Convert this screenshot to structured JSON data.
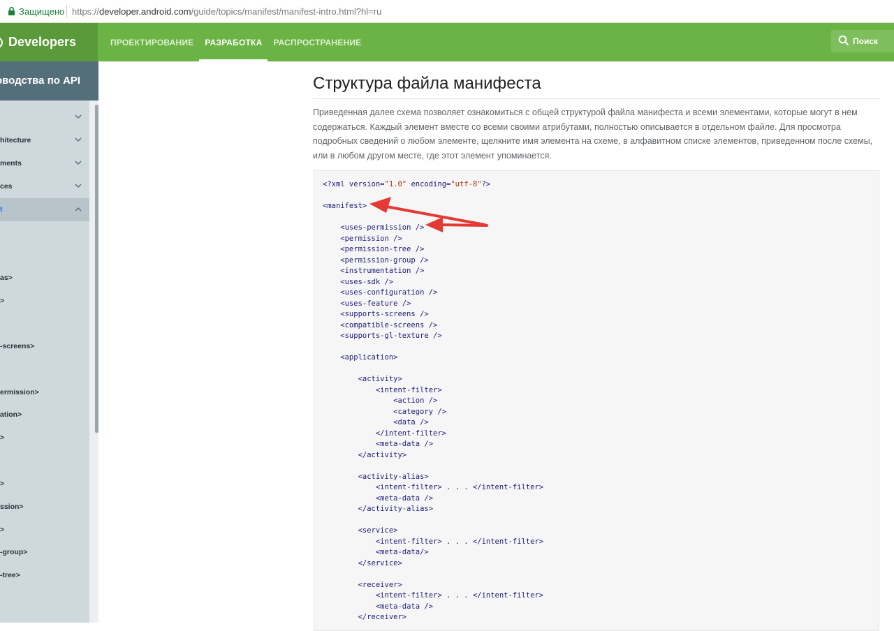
{
  "browser": {
    "secure_label": "Защищено",
    "url_prefix": "https://",
    "url_host": "developer.android.com",
    "url_path": "/guide/topics/manifest/manifest-intro.html?hl=ru"
  },
  "header": {
    "brand": "Developers",
    "nav": [
      {
        "label": "ПРОЕКТИРОВАНИЕ"
      },
      {
        "label": "РАЗРАБОТКА"
      },
      {
        "label": "РАСПРОСТРАНЕНИЕ"
      }
    ],
    "search_label": "Поиск"
  },
  "sidebar": {
    "title": "оводства по API",
    "sections": [
      {
        "label": "",
        "chevron": "chevron-down"
      },
      {
        "label": "hitecture",
        "chevron": "chevron-down"
      },
      {
        "label": "ments",
        "chevron": "chevron-down"
      },
      {
        "label": "ces",
        "chevron": "chevron-down"
      },
      {
        "label": "t",
        "chevron": "chevron-up"
      }
    ],
    "subitems": [
      "as>",
      ">",
      "-screens>",
      "ermission>",
      "ation>",
      ">",
      ">",
      "ssion>",
      ">",
      "-group>",
      "-tree>"
    ]
  },
  "main": {
    "title": "Структура файла манифеста",
    "intro": "Приведенная далее схема позволяет ознакомиться с общей структурой файла манифеста и всеми элементами, которые могут в нем содержаться. Каждый элемент вместе со всеми своими атрибутами, полностью описывается в отдельном файле. Для просмотра подробных сведений о любом элементе, щелкните имя элемента на схеме, в алфавитном списке элементов, приведенном после схемы, или в любом другом месте, где этот элемент упоминается.",
    "code_lines": [
      "<?xml version=\"1.0\" encoding=\"utf-8\"?>",
      "",
      "<manifest>",
      "",
      "    <uses-permission />",
      "    <permission />",
      "    <permission-tree />",
      "    <permission-group />",
      "    <instrumentation />",
      "    <uses-sdk />",
      "    <uses-configuration />",
      "    <uses-feature />",
      "    <supports-screens />",
      "    <compatible-screens />",
      "    <supports-gl-texture />",
      "",
      "    <application>",
      "",
      "        <activity>",
      "            <intent-filter>",
      "                <action />",
      "                <category />",
      "                <data />",
      "            </intent-filter>",
      "            <meta-data />",
      "        </activity>",
      "",
      "        <activity-alias>",
      "            <intent-filter> . . . </intent-filter>",
      "            <meta-data />",
      "        </activity-alias>",
      "",
      "        <service>",
      "            <intent-filter> . . . </intent-filter>",
      "            <meta-data/>",
      "        </service>",
      "",
      "        <receiver>",
      "            <intent-filter> . . . </intent-filter>",
      "            <meta-data />",
      "        </receiver>"
    ]
  },
  "colors": {
    "header_green": "#6ab344",
    "brand_green": "#5b9a3a",
    "sidebar_dark": "#546e7a",
    "sidebar_bg": "#cfd8dc",
    "arrow_red": "#e53935",
    "code_string": "#b4360a"
  }
}
